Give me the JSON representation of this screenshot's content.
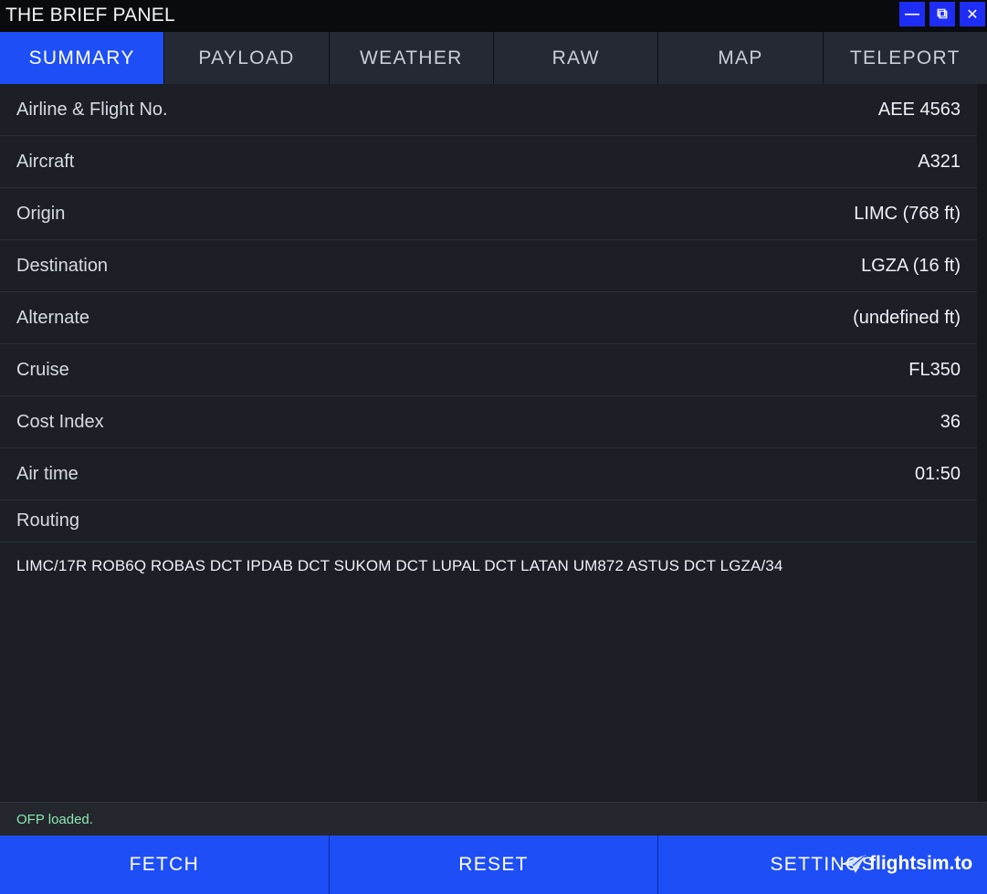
{
  "window": {
    "title": "THE BRIEF PANEL",
    "min_glyph": "—",
    "pop_glyph": "⧉",
    "close_glyph": "✕"
  },
  "tabs": [
    {
      "label": "SUMMARY",
      "active": true
    },
    {
      "label": "PAYLOAD",
      "active": false
    },
    {
      "label": "WEATHER",
      "active": false
    },
    {
      "label": "RAW",
      "active": false
    },
    {
      "label": "MAP",
      "active": false
    },
    {
      "label": "TELEPORT",
      "active": false
    }
  ],
  "summary": {
    "rows": [
      {
        "label": "Airline & Flight No.",
        "value": "AEE 4563"
      },
      {
        "label": "Aircraft",
        "value": "A321"
      },
      {
        "label": "Origin",
        "value": "LIMC (768 ft)"
      },
      {
        "label": "Destination",
        "value": "LGZA (16 ft)"
      },
      {
        "label": "Alternate",
        "value": "(undefined ft)"
      },
      {
        "label": "Cruise",
        "value": "FL350"
      },
      {
        "label": "Cost Index",
        "value": "36"
      },
      {
        "label": "Air time",
        "value": "01:50"
      }
    ],
    "routing_label": "Routing",
    "route": "LIMC/17R ROB6Q ROBAS DCT IPDAB DCT SUKOM DCT LUPAL DCT LATAN UM872 ASTUS DCT LGZA/34"
  },
  "status": {
    "text": "OFP loaded.",
    "color": "#8ee6b0"
  },
  "actions": {
    "fetch": "FETCH",
    "reset": "RESET",
    "settings": "SETTINGS"
  },
  "watermark": {
    "text": "flightsim.to"
  },
  "colors": {
    "accent": "#1e4ef5",
    "panel": "#1c1f26"
  }
}
